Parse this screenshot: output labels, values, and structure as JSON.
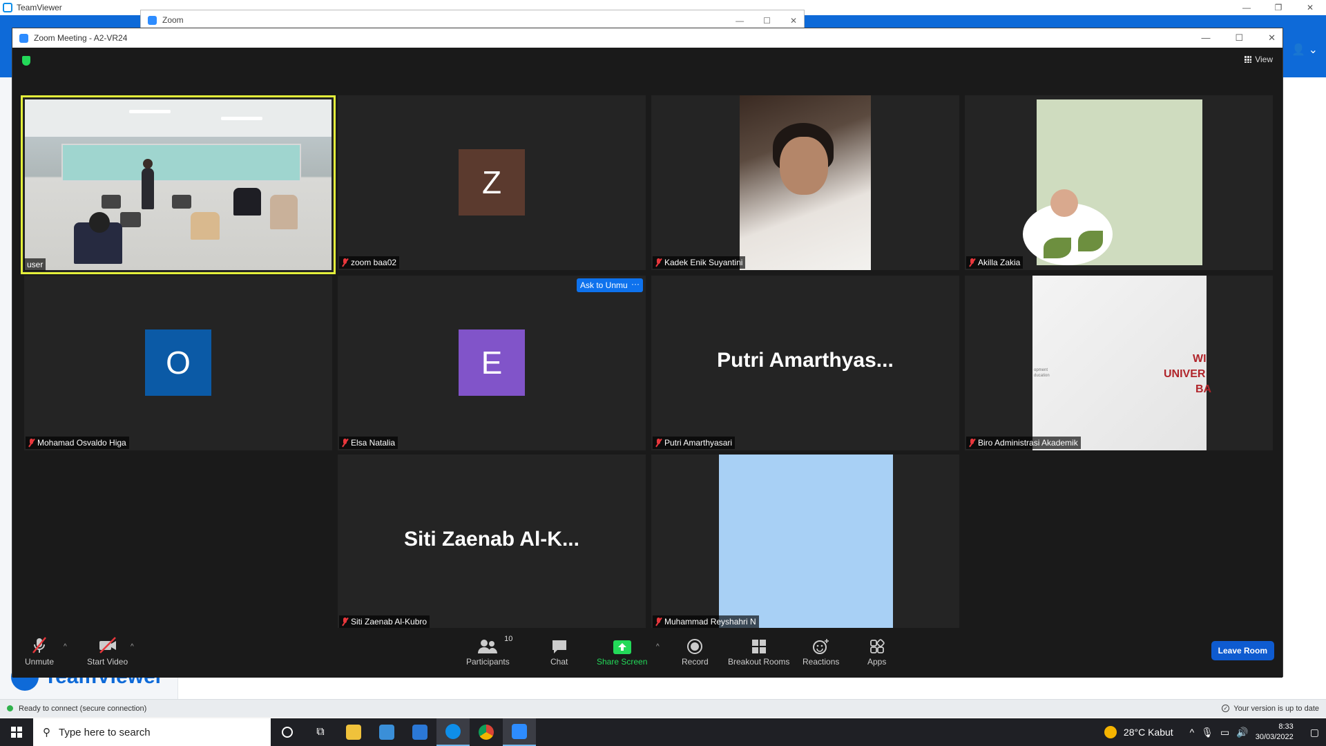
{
  "teamviewer": {
    "title": "TeamViewer",
    "brand": "TeamViewer",
    "status_left": "Ready to connect (secure connection)",
    "status_right": "Your version is up to date"
  },
  "zoom_launcher": {
    "title": "Zoom"
  },
  "meeting": {
    "title": "Zoom Meeting - A2-VR24",
    "view_label": "View",
    "accent_color": "#e4f03b"
  },
  "tiles": [
    {
      "name": "user",
      "muted": false,
      "kind": "video-classroom",
      "active": true
    },
    {
      "name": "zoom baa02",
      "muted": true,
      "kind": "avatar",
      "initial": "Z",
      "color": "#5b3a2e"
    },
    {
      "name": "Kadek Enik Suyantini",
      "muted": true,
      "kind": "video-person"
    },
    {
      "name": "Akilla Zakia",
      "muted": true,
      "kind": "image-floral"
    },
    {
      "name": "Mohamad Osvaldo Higa",
      "muted": true,
      "kind": "avatar",
      "initial": "O",
      "color": "#0b5aa6"
    },
    {
      "name": "Elsa Natalia",
      "muted": true,
      "kind": "avatar",
      "initial": "E",
      "color": "#8154c9"
    },
    {
      "name": "Putri Amarthyasari",
      "muted": true,
      "kind": "text",
      "display": "Putri  Amarthyas..."
    },
    {
      "name": "Biro Administrasi Akademik",
      "muted": true,
      "kind": "image-slide",
      "slide_lines": [
        "WI",
        "UNIVER",
        "BA"
      ],
      "slide_small": [
        "opment",
        "ducation"
      ]
    },
    {
      "name": "Siti Zaenab Al-Kubro",
      "muted": true,
      "kind": "text",
      "display": "Siti  Zaenab  Al-K..."
    },
    {
      "name": "Muhammad Reyshahri N",
      "muted": true,
      "kind": "image-blue"
    }
  ],
  "hover_actions": {
    "ask_unmute": "Ask to Unmute",
    "more": "···"
  },
  "toolbar": {
    "unmute": "Unmute",
    "start_video": "Start Video",
    "participants": "Participants",
    "participants_count": "10",
    "chat": "Chat",
    "share_screen": "Share Screen",
    "record": "Record",
    "breakout_rooms": "Breakout Rooms",
    "reactions": "Reactions",
    "apps": "Apps",
    "leave": "Leave Room"
  },
  "taskbar": {
    "search_placeholder": "Type here to search",
    "weather": "28°C  Kabut",
    "time": "8:33",
    "date": "30/03/2022"
  }
}
